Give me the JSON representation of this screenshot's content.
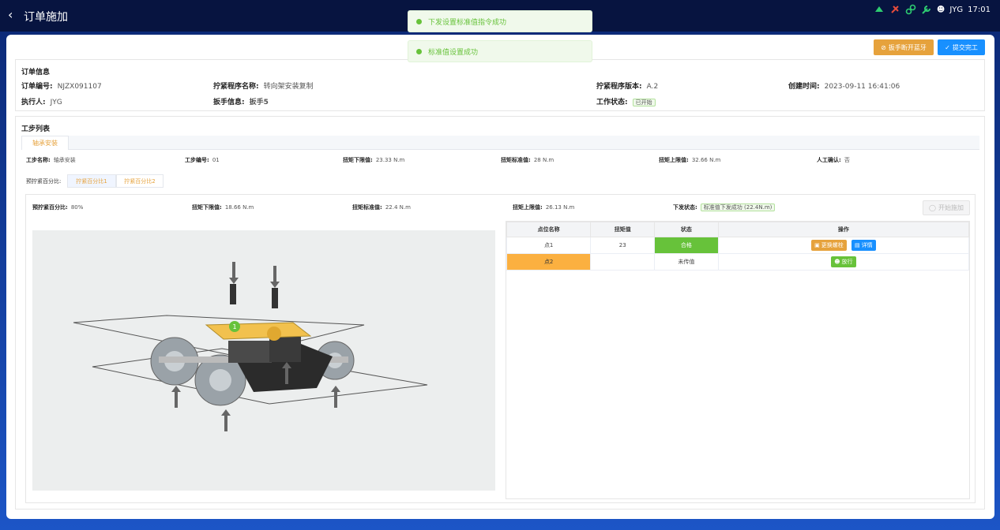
{
  "header": {
    "back_icon": "chevron-left-icon",
    "title": "订单施加",
    "user": "JYG",
    "time": "17:01"
  },
  "toasts": [
    {
      "text": "下发设置标准值指令成功"
    },
    {
      "text": "标准值设置成功"
    }
  ],
  "actions": {
    "disconnect_label": "扳手断开蓝牙",
    "submit_label": "提交完工"
  },
  "order_info": {
    "section_title": "订单信息",
    "order_no_label": "订单编号:",
    "order_no": "NJZX091107",
    "program_name_label": "拧紧程序名称:",
    "program_name": "转向架安装复制",
    "program_version_label": "拧紧程序版本:",
    "program_version": "A.2",
    "created_label": "创建时间:",
    "created": "2023-09-11 16:41:06",
    "executor_label": "执行人:",
    "executor": "JYG",
    "wrench_label": "扳手信息:",
    "wrench": "扳手5",
    "work_status_label": "工作状态:",
    "work_status": "已开始"
  },
  "step_list": {
    "section_title": "工步列表",
    "tabs": [
      {
        "label": "轴承安装"
      }
    ],
    "step_name_label": "工步名称:",
    "step_name": "轴承安装",
    "step_no_label": "工步编号:",
    "step_no": "01",
    "torque_low_label": "扭矩下限值:",
    "torque_low": "23.33 N.m",
    "torque_std_label": "扭矩标准值:",
    "torque_std": "28 N.m",
    "torque_high_label": "扭矩上限值:",
    "torque_high": "32.66 N.m",
    "manual_label": "人工确认:",
    "manual": "否",
    "pretight_label": "预拧紧百分比:",
    "pretight_tabs": [
      {
        "label": "拧紧百分比1"
      },
      {
        "label": "拧紧百分比2"
      }
    ]
  },
  "pretight": {
    "pct_label": "预拧紧百分比:",
    "pct": "80%",
    "low_label": "扭矩下限值:",
    "low": "18.66 N.m",
    "std_label": "扭矩标准值:",
    "std": "22.4 N.m",
    "high_label": "扭矩上限值:",
    "high": "26.13 N.m",
    "send_label": "下发状态:",
    "send_status": "标准值下发成功 (22.4N.m)",
    "start_button": "开始施加",
    "marker_number": "1"
  },
  "table": {
    "headers": [
      "点位名称",
      "扭矩值",
      "状态",
      "操作"
    ],
    "rows": [
      {
        "name": "点1",
        "torque": "23",
        "status": "合格",
        "actions": [
          "更换螺栓",
          "详情"
        ]
      },
      {
        "name": "点2",
        "torque": "",
        "status": "未传值",
        "actions": [
          "放行"
        ]
      }
    ]
  },
  "colors": {
    "accent_orange": "#e6a23c",
    "primary_blue": "#1890ff",
    "success_green": "#67c23a",
    "warn_yellow": "#fbb040",
    "topbar_bg": "#071440"
  }
}
